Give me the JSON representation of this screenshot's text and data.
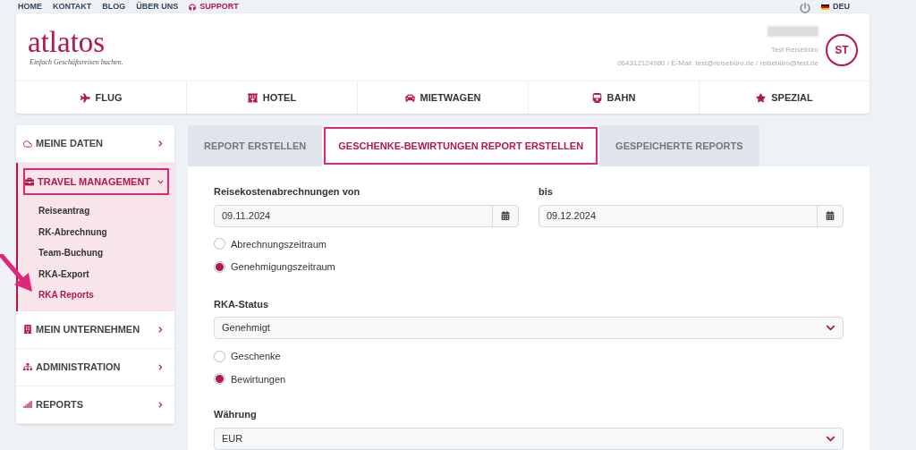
{
  "top_links": [
    {
      "label": "HOME",
      "kind": "plain"
    },
    {
      "label": "KONTAKT",
      "kind": "plain"
    },
    {
      "label": "BLOG",
      "kind": "plain"
    },
    {
      "label": "ÜBER UNS",
      "kind": "plain"
    },
    {
      "label": "SUPPORT",
      "kind": "support"
    }
  ],
  "language": "DEU",
  "logo": {
    "name": "atlatos",
    "slogan": "Einfach Geschäftsreisen buchen."
  },
  "user": {
    "company": "Test Reisebüro",
    "contact": "064312124980 / E-Mail: test@reisebüro.de / reisebüro@test.de",
    "initials": "ST"
  },
  "nav": [
    {
      "label": "FLUG"
    },
    {
      "label": "HOTEL"
    },
    {
      "label": "MIETWAGEN"
    },
    {
      "label": "BAHN"
    },
    {
      "label": "SPEZIAL"
    }
  ],
  "sidebar": [
    {
      "label": "MEINE DATEN",
      "expanded": false,
      "highlighted": false
    },
    {
      "label": "TRAVEL MANAGEMENT",
      "expanded": true,
      "highlighted": true,
      "children": [
        {
          "label": "Reiseantrag",
          "selected": false
        },
        {
          "label": "RK-Abrechnung",
          "selected": false
        },
        {
          "label": "Team-Buchung",
          "selected": false
        },
        {
          "label": "RKA-Export",
          "selected": false
        },
        {
          "label": "RKA Reports",
          "selected": true
        }
      ]
    },
    {
      "label": "MEIN UNTERNEHMEN",
      "expanded": false,
      "highlighted": false
    },
    {
      "label": "ADMINISTRATION",
      "expanded": false,
      "highlighted": false
    },
    {
      "label": "REPORTS",
      "expanded": false,
      "highlighted": false
    }
  ],
  "tabs": [
    {
      "label": "REPORT ERSTELLEN",
      "selected": false,
      "highlighted": false
    },
    {
      "label": "GESCHENKE-BEWIRTUNGEN REPORT ERSTELLEN",
      "selected": true,
      "highlighted": true
    },
    {
      "label": "GESPEICHERTE REPORTS",
      "selected": false,
      "highlighted": false
    }
  ],
  "form": {
    "from_label": "Reisekostenabrechnungen von",
    "from_value": "09.11.2024",
    "to_label": "bis",
    "to_value": "09.12.2024",
    "period": [
      {
        "label": "Abrechnungszeitraum",
        "selected": false
      },
      {
        "label": "Genehmigungszeitraum",
        "selected": true
      }
    ],
    "status_label": "RKA-Status",
    "status_value": "Genehmigt",
    "type": [
      {
        "label": "Geschenke",
        "selected": false
      },
      {
        "label": "Bewirtungen",
        "selected": true
      }
    ],
    "currency_label": "Währung",
    "currency_value": "EUR"
  }
}
